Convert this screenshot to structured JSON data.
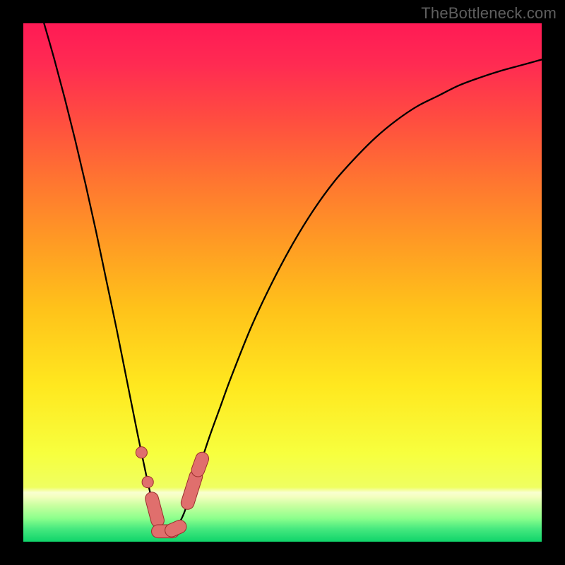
{
  "watermark": {
    "text": "TheBottleneck.com"
  },
  "chart_data": {
    "type": "line",
    "title": "",
    "xlabel": "",
    "ylabel": "",
    "x_range": [
      0,
      100
    ],
    "y_range": [
      0,
      100
    ],
    "series": [
      {
        "name": "bottleneck-curve",
        "description": "V-shaped bottleneck percentage curve; minimum near x≈27",
        "x": [
          4.0,
          6.0,
          8.0,
          10.0,
          12.0,
          14.0,
          16.0,
          18.0,
          20.0,
          22.0,
          24.0,
          25.0,
          26.0,
          27.0,
          28.0,
          29.0,
          30.0,
          31.0,
          32.0,
          34.0,
          36.0,
          38.0,
          40.0,
          44.0,
          48.0,
          52.0,
          56.0,
          60.0,
          64.0,
          68.0,
          72.0,
          76.0,
          80.0,
          84.0,
          88.0,
          92.0,
          96.0,
          100.0
        ],
        "values": [
          100.0,
          93.0,
          85.5,
          77.5,
          69.0,
          60.0,
          50.5,
          41.0,
          31.0,
          21.0,
          11.5,
          7.5,
          4.5,
          2.6,
          2.0,
          2.3,
          3.5,
          5.5,
          8.5,
          14.5,
          20.5,
          26.0,
          31.5,
          41.5,
          50.0,
          57.5,
          64.0,
          69.5,
          74.0,
          78.0,
          81.3,
          84.0,
          86.0,
          88.0,
          89.5,
          90.8,
          91.9,
          93.0
        ]
      }
    ],
    "markers": [
      {
        "shape": "circle",
        "x": 22.8,
        "y": 17.2,
        "r": 1.1
      },
      {
        "shape": "circle",
        "x": 24.0,
        "y": 11.5,
        "r": 1.1
      },
      {
        "shape": "capsule",
        "x1": 24.8,
        "y1": 8.3,
        "x2": 25.9,
        "y2": 4.1,
        "r": 1.2
      },
      {
        "shape": "capsule",
        "x1": 26.0,
        "y1": 2.0,
        "x2": 28.8,
        "y2": 2.0,
        "r": 1.2
      },
      {
        "shape": "capsule",
        "x1": 28.6,
        "y1": 2.2,
        "x2": 30.2,
        "y2": 2.9,
        "r": 1.2
      },
      {
        "shape": "capsule",
        "x1": 31.7,
        "y1": 7.5,
        "x2": 33.3,
        "y2": 12.6,
        "r": 1.2
      },
      {
        "shape": "capsule",
        "x1": 33.7,
        "y1": 13.8,
        "x2": 34.5,
        "y2": 16.0,
        "r": 1.2
      }
    ],
    "gradient_stops": [
      {
        "offset": 0.0,
        "color": "#ff1a55"
      },
      {
        "offset": 0.08,
        "color": "#ff2b52"
      },
      {
        "offset": 0.18,
        "color": "#ff4b41"
      },
      {
        "offset": 0.3,
        "color": "#ff7431"
      },
      {
        "offset": 0.42,
        "color": "#ff9a24"
      },
      {
        "offset": 0.55,
        "color": "#ffc21a"
      },
      {
        "offset": 0.7,
        "color": "#ffe81f"
      },
      {
        "offset": 0.83,
        "color": "#f7ff3e"
      },
      {
        "offset": 0.895,
        "color": "#efff61"
      },
      {
        "offset": 0.905,
        "color": "#f9ffd0"
      },
      {
        "offset": 0.913,
        "color": "#f4ffbf"
      },
      {
        "offset": 0.93,
        "color": "#c9ffa0"
      },
      {
        "offset": 0.955,
        "color": "#8cff8c"
      },
      {
        "offset": 0.975,
        "color": "#47e97f"
      },
      {
        "offset": 1.0,
        "color": "#0fd46a"
      }
    ],
    "marker_style": {
      "fill": "#e06f6d",
      "stroke": "#9a2e2c",
      "stroke_width": 1.0
    },
    "curve_style": {
      "stroke": "#000000",
      "stroke_width": 2.3
    }
  }
}
